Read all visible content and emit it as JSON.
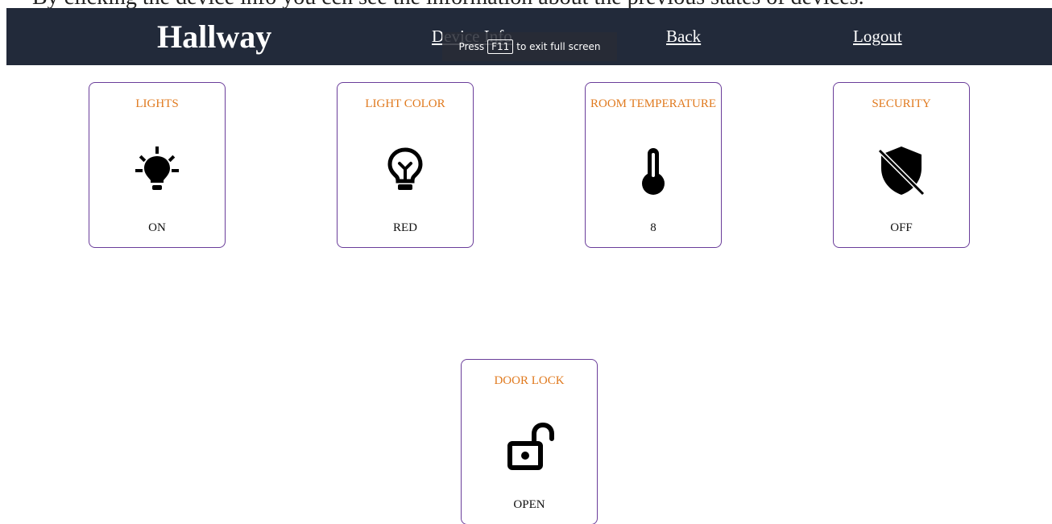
{
  "caption": "By clicking the device info you ccn see the information about the previous states of devices.",
  "header": {
    "title": "Hallway",
    "nav": {
      "device_info": "Device Info",
      "back": "Back",
      "logout": "Logout"
    }
  },
  "fullscreen_toast": {
    "prefix": "Press",
    "key": "F11",
    "suffix": "to exit full screen"
  },
  "cards": {
    "lights": {
      "title": "LIGHTS",
      "value": "ON",
      "icon": "lightbulb-on-icon"
    },
    "light_color": {
      "title": "LIGHT COLOR",
      "value": "RED",
      "icon": "lightbulb-outline-icon"
    },
    "room_temperature": {
      "title": "ROOM TEMPERATURE",
      "value": "8",
      "icon": "thermometer-icon"
    },
    "security": {
      "title": "SECURITY",
      "value": "OFF",
      "icon": "shield-off-icon"
    },
    "door_lock": {
      "title": "DOOR LOCK",
      "value": "OPEN",
      "icon": "unlocked-padlock-icon"
    }
  },
  "colors": {
    "navbar_bg": "#222a3a",
    "card_border": "#6a3d9a",
    "card_title": "#e07a1f"
  }
}
